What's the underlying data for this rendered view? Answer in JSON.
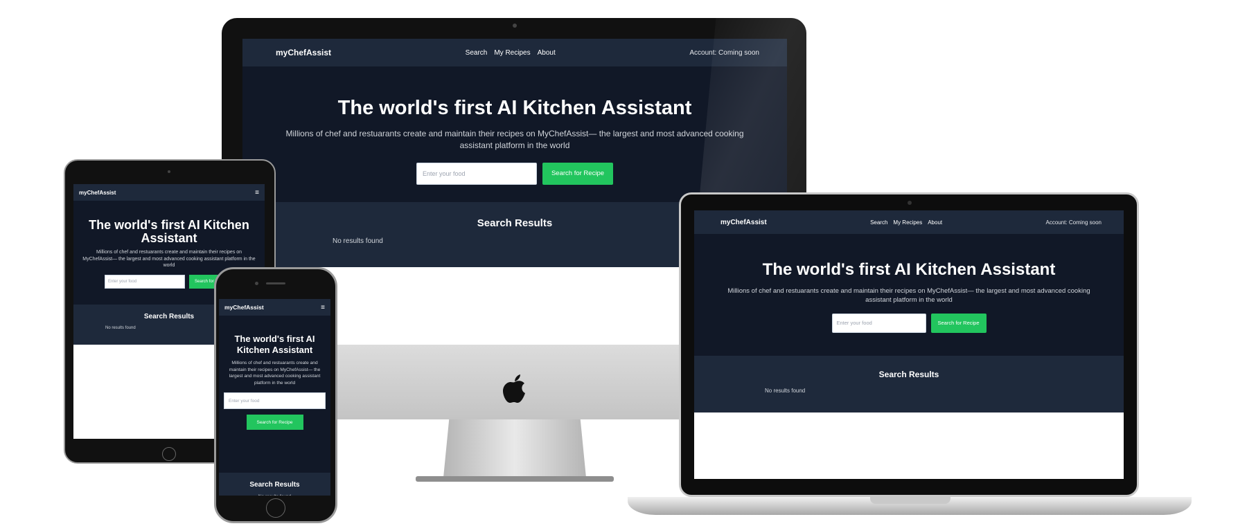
{
  "app": {
    "brand": "myChefAssist",
    "nav_links": [
      "Search",
      "My Recipes",
      "About"
    ],
    "account": "Account: Coming soon",
    "menu_glyph": "≡",
    "hero_title": "The world's first AI Kitchen Assistant",
    "hero_subtitle": "Millions of chef and restuarants create and maintain their recipes on MyChefAssist— the largest and most advanced cooking assistant platform in the world",
    "search_placeholder": "Enter your food",
    "search_button": "Search for Recipe",
    "results_title": "Search Results",
    "no_results": "No results found"
  },
  "colors": {
    "nav_bg": "#1e293b",
    "hero_bg": "#111827",
    "accent": "#22c55e"
  },
  "icons": {
    "apple_logo": "apple-logo-icon",
    "hamburger": "hamburger-menu-icon"
  }
}
